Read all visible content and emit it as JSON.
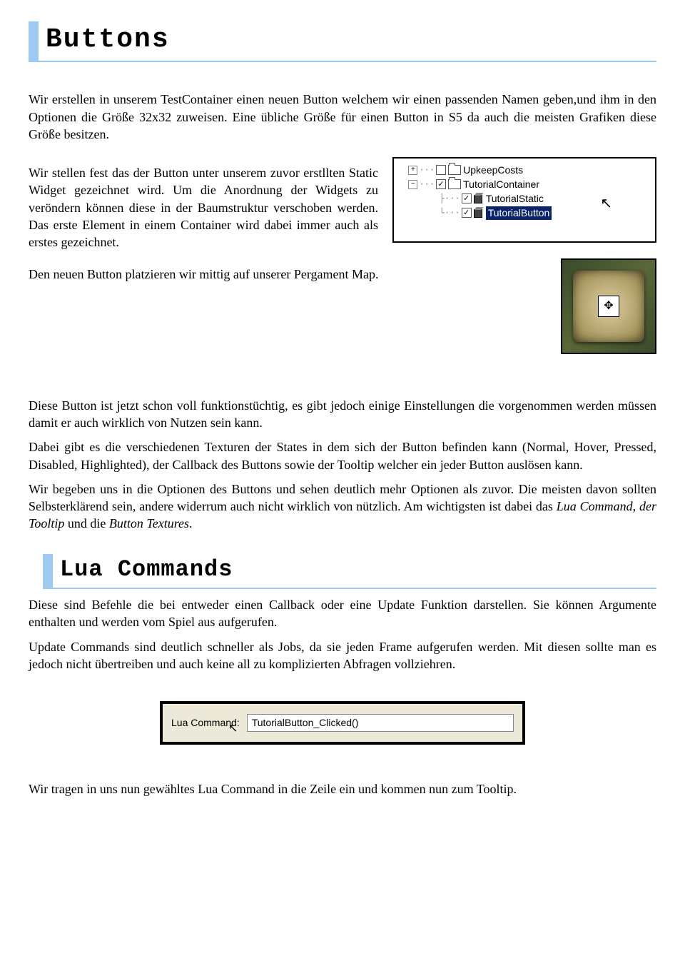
{
  "heading1": "Buttons",
  "para1": "Wir erstellen in unserem TestContainer einen neuen Button welchem wir einen passenden Namen geben,und ihm in den Optionen die Größe 32x32 zuweisen. Eine übliche Größe für einen Button in S5 da auch die meisten Grafiken diese Größe besitzen.",
  "para2": "Wir stellen fest das der Button unter unserem zuvor erstllten Static Widget gezeichnet wird. Um die Anordnung der Widgets zu veröndern können diese in der Baumstruktur verschoben werden. Das erste Element in einem Container wird dabei immer auch als erstes gezeichnet.",
  "para3": "Den neuen Button platzieren wir mittig auf unserer Pergament Map.",
  "para4": "Diese Button ist jetzt schon voll funktionstüchtig, es gibt jedoch einige Einstellungen die vorgenommen werden müssen damit er auch wirklich von Nutzen sein kann.",
  "para5": "Dabei gibt es die verschiedenen Texturen der States in dem sich der Button befinden kann (Normal, Hover, Pressed, Disabled, Highlighted), der Callback des Buttons sowie der Tooltip welcher ein jeder Button auslösen kann.",
  "para6a": "Wir begeben uns in die Optionen des Buttons und sehen deutlich mehr Optionen als zuvor. Die meisten davon sollten Selbsterklärend sein, andere widerrum auch nicht wirklich von nützlich. Am wichtigsten ist dabei das ",
  "para6b": "Lua Command",
  "para6c": ", ",
  "para6d": "der Tooltip",
  "para6e": " und die ",
  "para6f": "Button Textures",
  "para6g": ".",
  "heading2": "Lua Commands",
  "para7": "Diese sind Befehle die bei entweder einen Callback oder eine Update Funktion darstellen. Sie können Argumente enthalten und werden vom Spiel aus aufgerufen.",
  "para8": "Update Commands sind deutlich schneller als Jobs, da sie jeden Frame aufgerufen werden. Mit diesen sollte man es jedoch nicht übertreiben und auch keine all zu komplizierten Abfragen vollziehren.",
  "para9": "Wir tragen in uns nun gewähltes Lua Command in die Zeile ein und kommen nun zum Tooltip.",
  "tree": {
    "items": [
      "UpkeepCosts",
      "TutorialContainer",
      "TutorialStatic",
      "TutorialButton"
    ]
  },
  "lua": {
    "label": "Lua Command:",
    "value": "TutorialButton_Clicked()"
  }
}
